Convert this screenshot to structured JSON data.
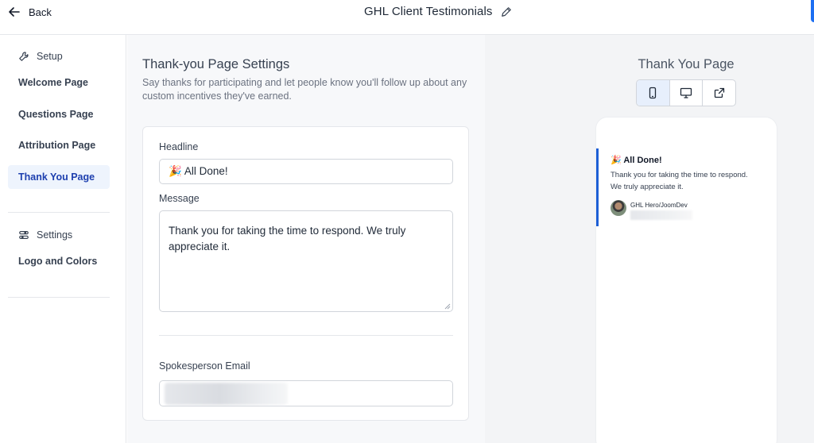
{
  "header": {
    "back_label": "Back",
    "title": "GHL Client Testimonials"
  },
  "sidebar": {
    "setup_label": "Setup",
    "pages": [
      {
        "label": "Welcome Page"
      },
      {
        "label": "Questions Page"
      },
      {
        "label": "Attribution Page"
      },
      {
        "label": "Thank You Page",
        "active": true
      }
    ],
    "settings_label": "Settings",
    "settings_items": [
      {
        "label": "Logo and Colors"
      }
    ]
  },
  "main": {
    "heading": "Thank-you Page Settings",
    "description": "Say thanks for participating and let people know you'll follow up about any custom incentives they've earned.",
    "headline_label": "Headline",
    "headline_value": "🎉 All Done!",
    "message_label": "Message",
    "message_value": "Thank you for taking the time to respond. We truly appreciate it.",
    "spokesperson_label": "Spokesperson Email"
  },
  "preview": {
    "title": "Thank You Page",
    "devices": [
      "mobile-icon",
      "desktop-icon",
      "external-link-icon"
    ],
    "active_device": "mobile",
    "headline": "🎉 All Done!",
    "message": "Thank you for taking the time to respond. We truly appreciate it.",
    "person_name": "GHL Hero/JoomDev"
  },
  "colors": {
    "accent": "#1d6ff2",
    "active_bg": "#eef4fd",
    "quote_bar": "#1d5fd6"
  }
}
